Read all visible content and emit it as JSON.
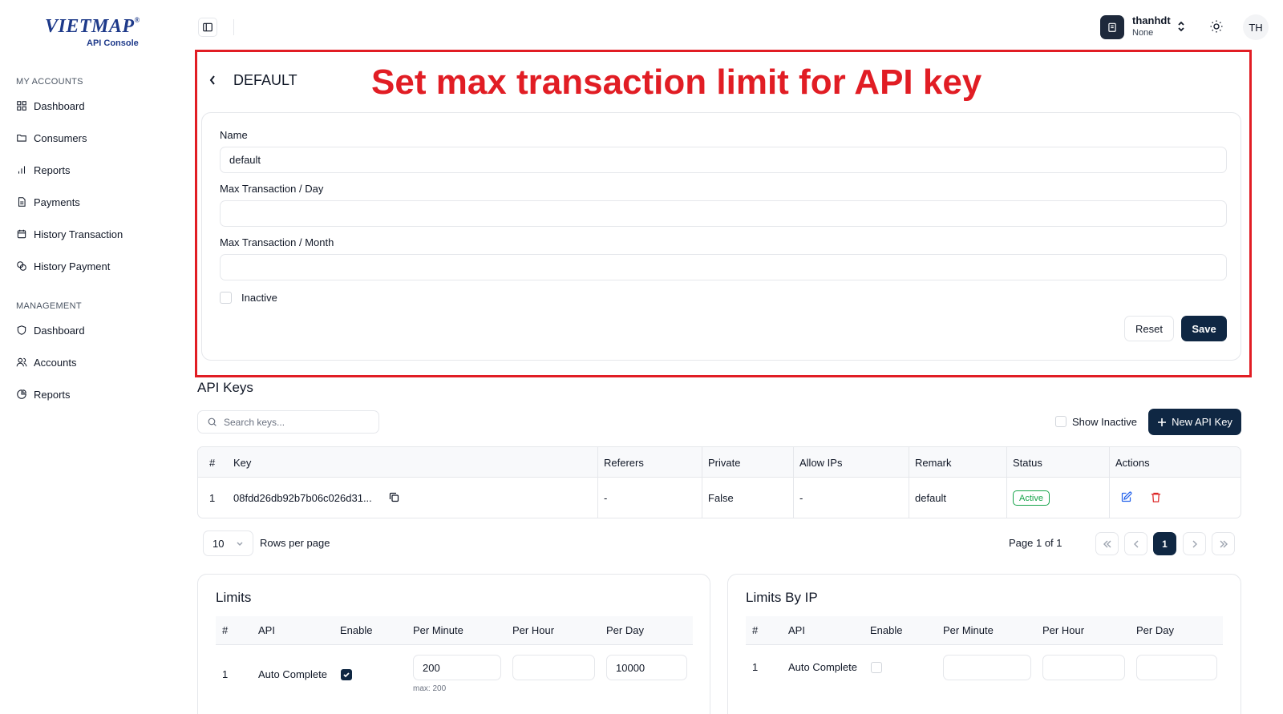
{
  "brand": {
    "name": "VIETMAP",
    "reg": "®",
    "sub": "API Console"
  },
  "sidebar": {
    "my_accounts_title": "MY ACCOUNTS",
    "my_accounts": [
      {
        "label": "Dashboard",
        "icon": "grid-icon"
      },
      {
        "label": "Consumers",
        "icon": "folder-icon"
      },
      {
        "label": "Reports",
        "icon": "bar-chart-icon"
      },
      {
        "label": "Payments",
        "icon": "file-text-icon"
      },
      {
        "label": "History Transaction",
        "icon": "calendar-icon"
      },
      {
        "label": "History Payment",
        "icon": "coins-icon"
      }
    ],
    "management_title": "MANAGEMENT",
    "management": [
      {
        "label": "Dashboard",
        "icon": "shield-icon"
      },
      {
        "label": "Accounts",
        "icon": "users-icon"
      },
      {
        "label": "Reports",
        "icon": "pie-chart-icon"
      }
    ]
  },
  "header": {
    "user_name": "thanhdt",
    "user_sub": "None",
    "avatar_initials": "TH"
  },
  "annotation": "Set max transaction limit for API key",
  "page": {
    "title": "DEFAULT"
  },
  "form": {
    "name_label": "Name",
    "name_value": "default",
    "max_day_label": "Max Transaction / Day",
    "max_day_value": "",
    "max_month_label": "Max Transaction / Month",
    "max_month_value": "",
    "inactive_label": "Inactive",
    "reset_label": "Reset",
    "save_label": "Save"
  },
  "api_keys": {
    "title": "API Keys",
    "search_placeholder": "Search keys...",
    "show_inactive_label": "Show Inactive",
    "new_key_label": "New API Key",
    "columns": [
      "#",
      "Key",
      "Referers",
      "Private",
      "Allow IPs",
      "Remark",
      "Status",
      "Actions"
    ],
    "rows": [
      {
        "num": "1",
        "key": "08fdd26db92b7b06c026d31...",
        "referers": "-",
        "private": "False",
        "allow_ips": "-",
        "remark": "default",
        "status": "Active"
      }
    ]
  },
  "pagination": {
    "rows_per_page_value": "10",
    "rows_per_page_label": "Rows per page",
    "page_info": "Page 1 of 1",
    "current_page": "1"
  },
  "limits": {
    "title": "Limits",
    "columns": [
      "#",
      "API",
      "Enable",
      "Per Minute",
      "Per Hour",
      "Per Day"
    ],
    "rows": [
      {
        "num": "1",
        "api": "Auto Complete",
        "enabled": true,
        "per_minute": "200",
        "per_hour": "",
        "per_day": "10000",
        "hint": "max: 200"
      }
    ]
  },
  "limits_by_ip": {
    "title": "Limits By IP",
    "columns": [
      "#",
      "API",
      "Enable",
      "Per Minute",
      "Per Hour",
      "Per Day"
    ],
    "rows": [
      {
        "num": "1",
        "api": "Auto Complete",
        "enabled": false,
        "per_minute": "",
        "per_hour": "",
        "per_day": ""
      }
    ]
  },
  "colors": {
    "accent": "#0f2743",
    "annotation": "#e11d24",
    "active": "#16a34a",
    "edit": "#2563eb",
    "delete": "#dc2626"
  }
}
